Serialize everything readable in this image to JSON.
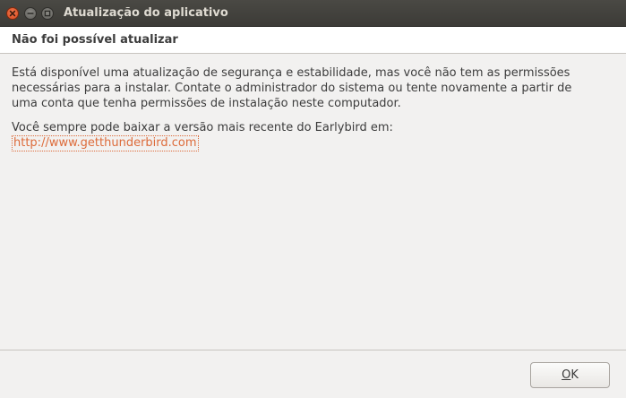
{
  "window": {
    "title": "Atualização do aplicativo",
    "controls": {
      "close_icon": "close-icon",
      "minimize_icon": "minimize-icon",
      "maximize_icon": "maximize-icon"
    }
  },
  "header": {
    "title": "Não foi possível atualizar"
  },
  "body": {
    "message": "Está disponível uma atualização de segurança e estabilidade, mas você  não tem as permissões\nnecessárias para a instalar. Contate o administrador  do sistema ou tente novamente a partir de\numa conta que tenha  permissões de instalação neste computador.",
    "download_text": "Você sempre pode baixar a versão mais recente do Earlybird em:",
    "download_link": "http://www.getthunderbird.com"
  },
  "footer": {
    "ok_label": "OK",
    "ok_mnemonic": "O",
    "ok_rest": "K"
  },
  "colors": {
    "titlebar": "#3c3b37",
    "close_button": "#e05a2b",
    "link": "#dd6b3a",
    "background": "#f2f1f0"
  }
}
